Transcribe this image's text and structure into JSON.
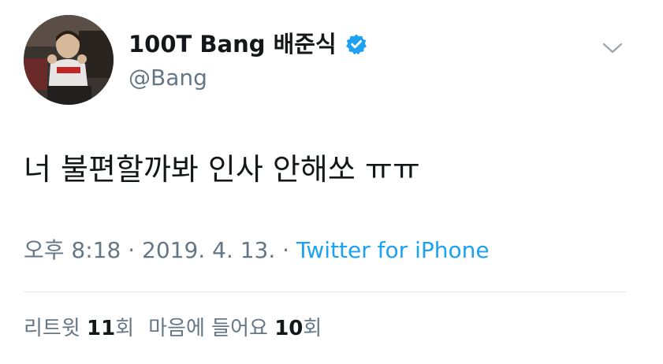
{
  "tweet": {
    "author": {
      "display_name": "100T Bang 배준식",
      "handle": "@Bang",
      "verified": true
    },
    "text": "너 불편할까봐 인사 안해쏘 ㅠㅠ",
    "meta": {
      "time": "오후 8:18",
      "separator1": " · ",
      "date": "2019. 4. 13.",
      "separator2": " · ",
      "source": "Twitter for iPhone"
    },
    "stats": {
      "retweets_label": "리트윗",
      "retweets_count": "11",
      "retweets_unit": "회",
      "likes_label": "마음에 들어요",
      "likes_count": "10",
      "likes_unit": "회"
    }
  },
  "colors": {
    "text": "#14171a",
    "secondary": "#657786",
    "link": "#1da1f2",
    "verified": "#1da1f2",
    "divider": "#e1e8ed"
  },
  "icons": {
    "verified": "verified-badge-icon",
    "menu": "chevron-down-icon"
  }
}
